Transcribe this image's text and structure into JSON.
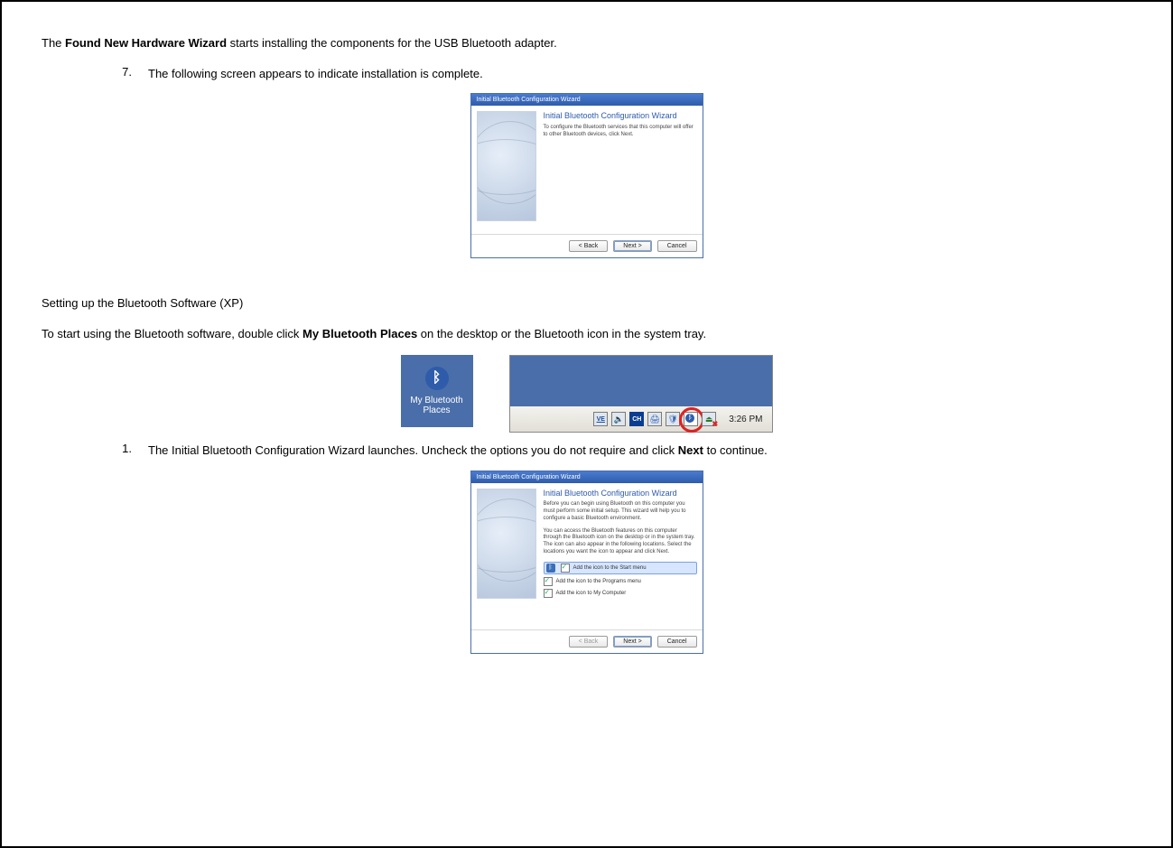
{
  "intro": {
    "prefix": "The ",
    "bold": "Found New Hardware Wizard",
    "suffix": " starts installing the components for the USB Bluetooth adapter."
  },
  "step7": {
    "num": "7.",
    "text": "The following screen appears to indicate installation is complete."
  },
  "wizard1": {
    "title": "Initial Bluetooth Configuration Wizard",
    "heading": "Initial Bluetooth Configuration Wizard",
    "sub": "To configure the Bluetooth services that this computer will offer to other Bluetooth devices, click Next.",
    "back": "< Back",
    "next": "Next >",
    "cancel": "Cancel"
  },
  "section2": {
    "heading": "Setting up the Bluetooth Software (XP)",
    "body_prefix": "To start using the Bluetooth software, double click ",
    "body_bold": "My Bluetooth Places",
    "body_suffix": " on the desktop or the Bluetooth icon in the system tray."
  },
  "icon_tile": {
    "glyph": "ᛒ",
    "line1": "My Bluetooth",
    "line2": "Places"
  },
  "tray": {
    "ve": "VE",
    "ch": "CH",
    "clock": "3:26 PM"
  },
  "step1b": {
    "num": "1.",
    "text_prefix": "The Initial Bluetooth Configuration Wizard launches. Uncheck the options you do not require and click ",
    "text_bold": "Next",
    "text_suffix": " to continue."
  },
  "wizard2": {
    "title": "Initial Bluetooth Configuration Wizard",
    "heading": "Initial Bluetooth Configuration Wizard",
    "sub1": "Before you can begin using Bluetooth on this computer you must perform some initial setup. This wizard will help you to configure a basic Bluetooth environment.",
    "sub2": "You can access the Bluetooth features on this computer through the Bluetooth icon on the desktop or in the system tray. The icon can also appear in the following locations. Select the locations you want the icon to appear and click Next.",
    "opt1": "Add the icon to the Start menu",
    "opt2": "Add the icon to the Programs menu",
    "opt3": "Add the icon to My Computer",
    "back": "< Back",
    "next": "Next >",
    "cancel": "Cancel",
    "bt_glyph": "ᛒ"
  }
}
